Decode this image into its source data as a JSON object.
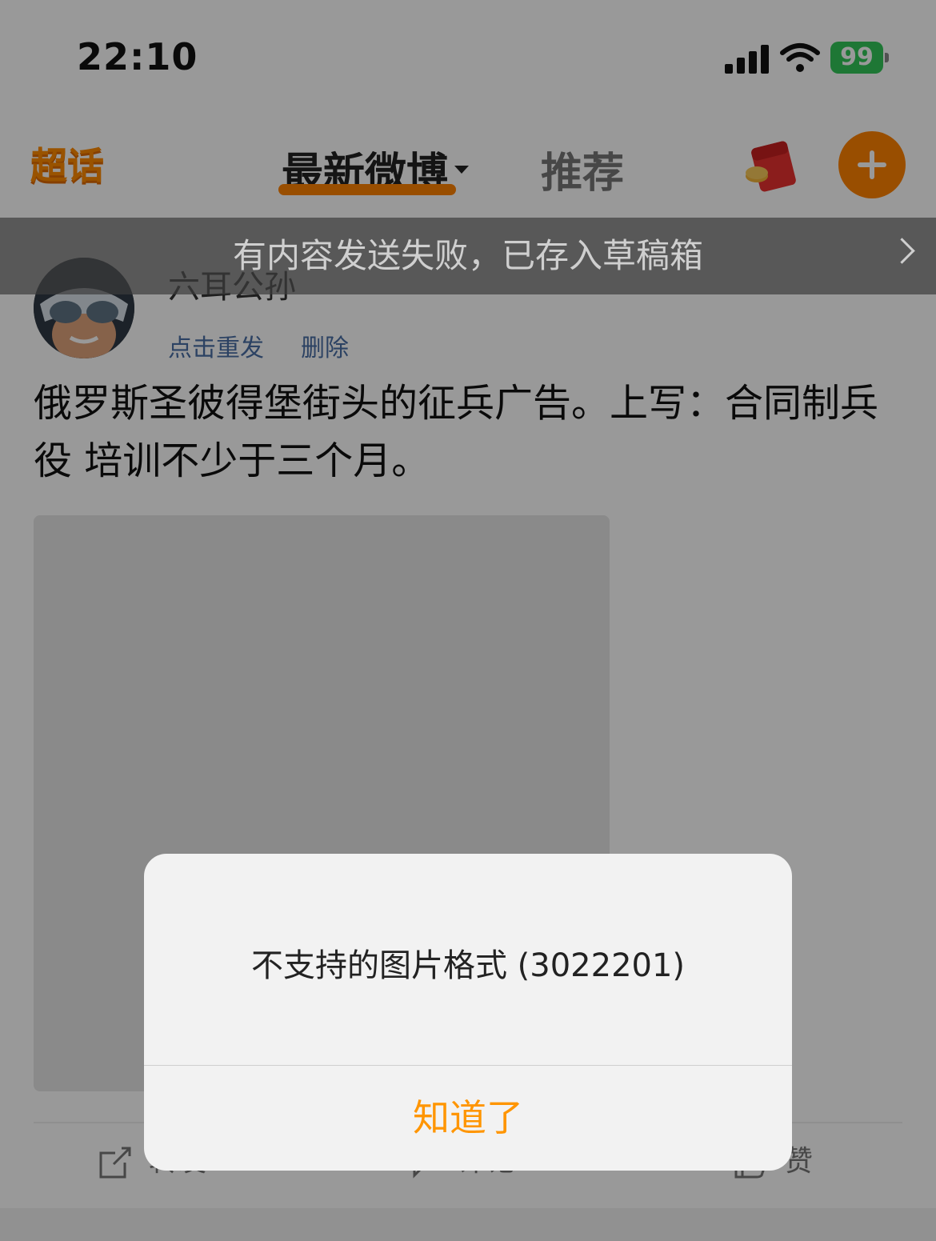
{
  "status_bar": {
    "time": "22:10",
    "battery": "99"
  },
  "header": {
    "logo": "超话",
    "tab_latest": "最新微博",
    "tab_recommend": "推荐",
    "accent_color": "#ff8200"
  },
  "toast": {
    "text": "有内容发送失败，已存入草稿箱"
  },
  "post": {
    "username": "六耳公孙",
    "resend_label": "点击重发",
    "delete_label": "删除",
    "text": "俄罗斯圣彼得堡街头的征兵广告。上写：合同制兵役  培训不少于三个月。",
    "actions": {
      "forward": "转发",
      "comment": "评论",
      "like": "赞"
    }
  },
  "alert": {
    "message": "不支持的图片格式 (3022201)",
    "button": "知道了",
    "button_color": "#ff9500"
  },
  "icons": [
    "signal-icon",
    "wifi-icon",
    "battery-icon",
    "red-packet-icon",
    "plus-icon",
    "chevron-right-icon",
    "forward-icon",
    "comment-icon",
    "like-icon"
  ]
}
